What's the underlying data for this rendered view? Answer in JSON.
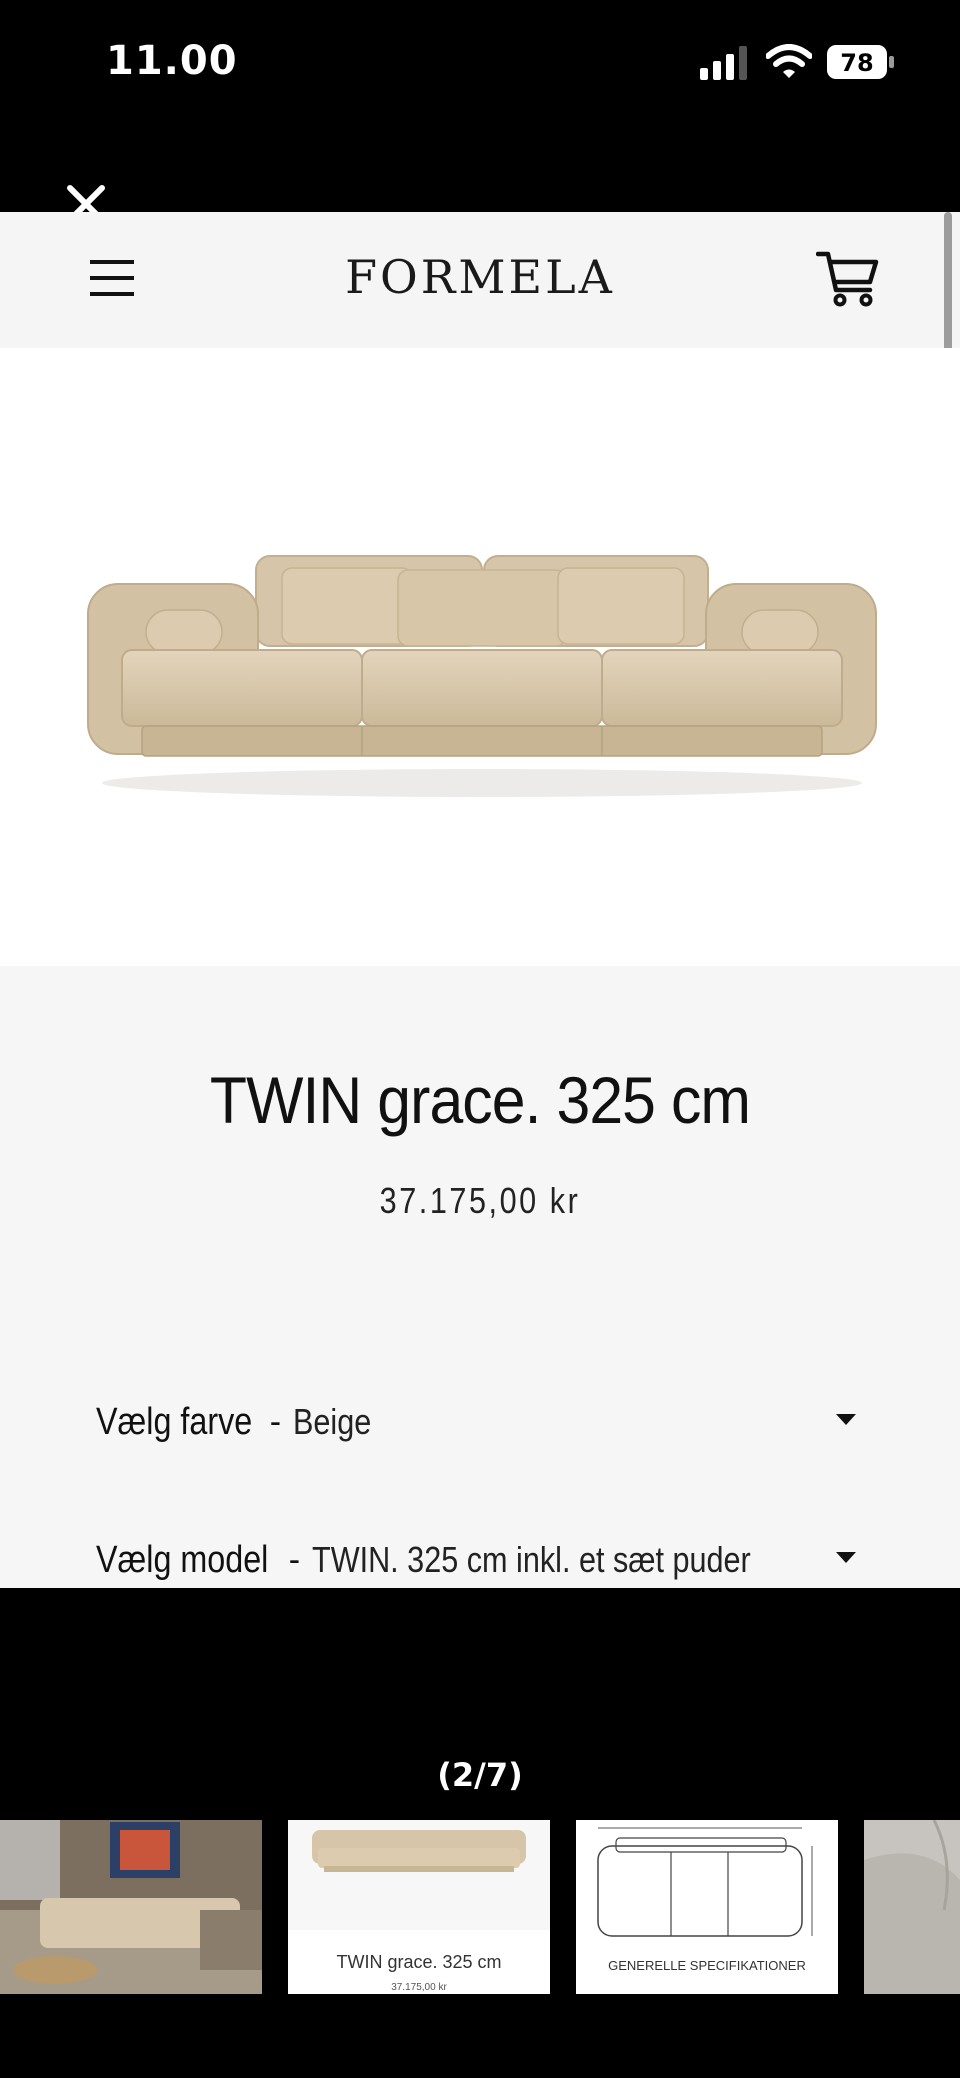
{
  "status_bar": {
    "time": "11.00",
    "battery": "78"
  },
  "header": {
    "logo": "FORMELA"
  },
  "product": {
    "title": "TWIN grace. 325 cm",
    "price": "37.175,00 kr"
  },
  "options": {
    "color": {
      "label": "Vælg farve",
      "separator": "-",
      "value": "Beige"
    },
    "model": {
      "label": "Vælg model",
      "separator": "-",
      "value": "TWIN. 325 cm inkl. et sæt puder"
    }
  },
  "gallery": {
    "counter": "(2/7)",
    "thumbs": [
      {
        "caption": ""
      },
      {
        "caption": "TWIN grace. 325 cm",
        "sub": "37.175,00 kr"
      },
      {
        "caption": "GENERELLE SPECIFIKATIONER"
      },
      {
        "caption": ""
      }
    ]
  },
  "colors": {
    "sofa": "#d9c8ac",
    "background": "#f6f6f6",
    "accent": "#111111"
  }
}
